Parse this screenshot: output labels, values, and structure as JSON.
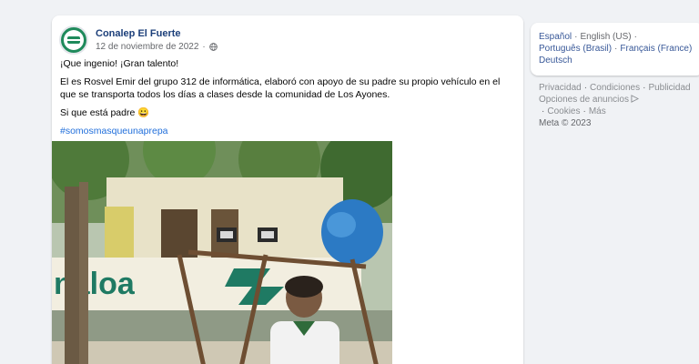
{
  "post": {
    "page_name": "Conalep El Fuerte",
    "date": "12 de noviembre de 2022",
    "dot": "·",
    "line1": "¡Que ingenio! ¡Gran talento!",
    "line2": "El es Rosvel Emir del grupo 312 de informática, elaboró con apoyo de su padre su propio vehículo en el que se transporta todos los días a clases desde la comunidad de Los Ayones.",
    "line3": "Si que está padre 😀",
    "hashtag": "#somosmasqueunaprepa",
    "photo_sign_text": "naloa",
    "colors": {
      "name": "#1c3f7a",
      "link": "#216fdb",
      "brand_green": "#1f8a5b"
    }
  },
  "languages": {
    "items": [
      "Español",
      "English (US)",
      "Português (Brasil)",
      "Français (France)",
      "Deutsch"
    ],
    "separator": "·"
  },
  "footer": {
    "links": [
      "Privacidad",
      "Condiciones",
      "Publicidad",
      "Opciones de anuncios",
      "Cookies",
      "Más"
    ],
    "separator": "·",
    "ad_choices_icon": "ad-choices-icon",
    "copyright": "Meta © 2023"
  }
}
